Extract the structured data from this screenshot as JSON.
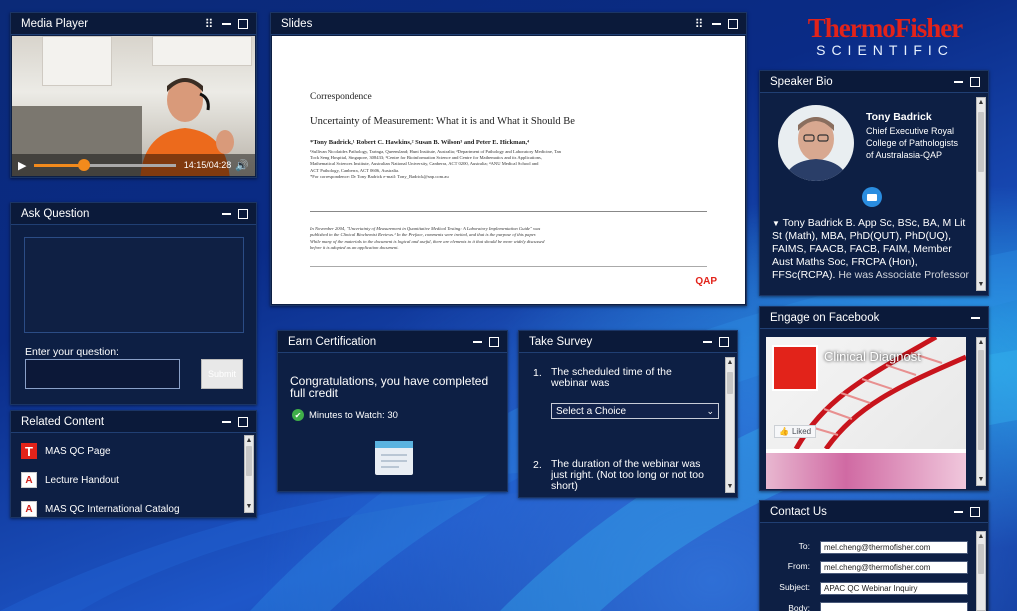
{
  "media_player": {
    "title": "Media Player",
    "time": "14:15/04:28"
  },
  "slides": {
    "title": "Slides",
    "section": "Correspondence",
    "heading": "Uncertainty of Measurement: What it is and What it Should Be",
    "authors": "*Tony Badrick,¹ Robert C. Hawkins,² Susan B. Wilson³ and Peter E. Hickman,⁴",
    "affiliations": [
      "¹Sullivan Nicolaides Pathology, Taringa, Queensland; Hunt Institute, Australia; ²Department of Pathology and Laboratory Medicine, Tan",
      "Tock Seng Hospital, Singapore, 308433; ³Centre for Bioinformation Science and Centre for Mathematics and its Applications,",
      "Mathematical Sciences Institute, Australian National University, Canberra, ACT 0200, Australia; ⁴ANU Medical School and",
      "ACT Pathology, Canberra, ACT 0606, Australia.",
      "*For correspondence: Dr Tony Badrick e-mail: Tony_Badrick@snp.com.au"
    ],
    "abstract": [
      "In November 2004, \"Uncertainty of Measurement in Quantitative Medical Testing: A Laboratory Implementation Guide\" was",
      "published in the Clinical Biochemist Reviews.¹ In the Preface, comments were invited, and that is the purpose of this paper.",
      "While many of the materials in the document is logical and useful, there are elements to it that should be more widely discussed",
      "before it is adopted as an application document."
    ],
    "logo": "QAP"
  },
  "ask_question": {
    "title": "Ask Question",
    "prompt": "Enter your question:",
    "submit_label": "Submit"
  },
  "related_content": {
    "title": "Related Content",
    "items": [
      {
        "label": "MAS QC Page",
        "icon": "brand-t-icon"
      },
      {
        "label": "Lecture Handout",
        "icon": "pdf-icon"
      },
      {
        "label": "MAS QC International Catalog",
        "icon": "pdf-icon"
      }
    ]
  },
  "earn_certification": {
    "title": "Earn Certification",
    "message": "Congratulations, you have completed full credit",
    "minutes_label": "Minutes to Watch: 30"
  },
  "take_survey": {
    "title": "Take Survey",
    "q1_num": "1.",
    "q1": "The scheduled time of the webinar was",
    "q1_select": "Select a Choice",
    "q2_num": "2.",
    "q2": "The duration of the webinar was just right. (Not too long or not too short)"
  },
  "brand": {
    "logo_line1": "ThermoFisher",
    "logo_line2": "SCIENTIFIC",
    "color": "#e2231a"
  },
  "speaker_bio": {
    "title": "Speaker Bio",
    "name": "Tony Badrick",
    "role": "Chief Executive Royal College of Pathologists of Australasia-QAP",
    "bio": "Tony Badrick B. App Sc, BSc, BA, M Lit St (Math), MBA, PhD(QUT), PhD(UQ), FAIMS, FAACB, FACB, FAIM, Member Aust Maths Soc, FRCPA (Hon), FFSc(RCPA).",
    "bio_more": "He was Associate Professor"
  },
  "facebook": {
    "title": "Engage on Facebook",
    "page_name": "Clinical Diagnost",
    "like_label": "Liked"
  },
  "contact": {
    "title": "Contact Us",
    "to_label": "To:",
    "from_label": "From:",
    "subject_label": "Subject:",
    "body_label": "Body:",
    "to": "mel.cheng@thermofisher.com",
    "from": "mel.cheng@thermofisher.com",
    "subject": "APAC QC Webinar Inquiry"
  }
}
